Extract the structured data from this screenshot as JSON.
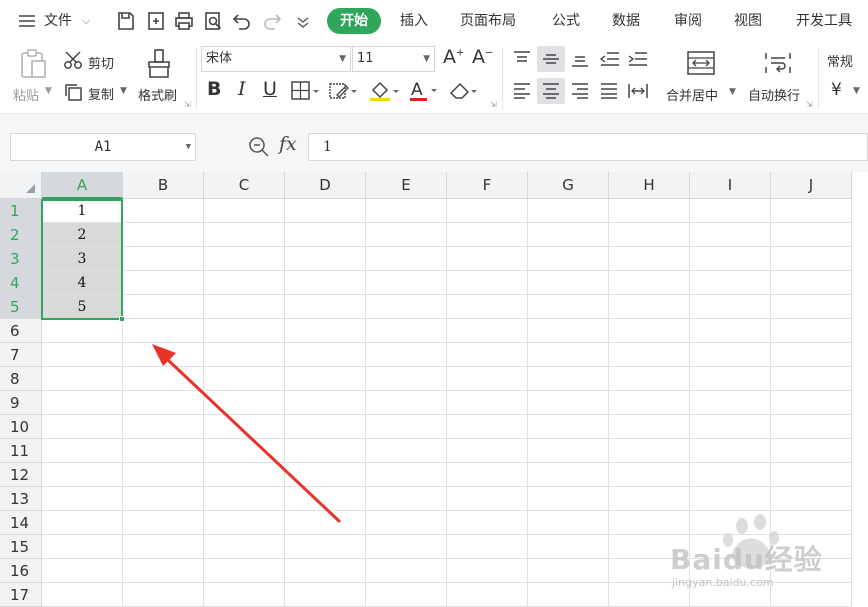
{
  "menu": {
    "file_label": "文件",
    "tabs": [
      "开始",
      "插入",
      "页面布局",
      "公式",
      "数据",
      "审阅",
      "视图",
      "开发工具"
    ]
  },
  "ribbon": {
    "paste": "粘贴",
    "cut": "剪切",
    "copy": "复制",
    "format_painter": "格式刷",
    "font_name": "宋体",
    "font_size": "11",
    "merge_center": "合并居中",
    "wrap_text": "自动换行",
    "number_format": "常规",
    "currency": "¥"
  },
  "formula_bar": {
    "name_box": "A1",
    "fx": "fx",
    "value": "1"
  },
  "sheet": {
    "columns": [
      "A",
      "B",
      "C",
      "D",
      "E",
      "F",
      "G",
      "H",
      "I",
      "J"
    ],
    "rows": [
      "1",
      "2",
      "3",
      "4",
      "5",
      "6",
      "7",
      "8",
      "9",
      "10",
      "11",
      "12",
      "13",
      "14",
      "15",
      "16",
      "17"
    ],
    "col_a_values": [
      "1",
      "2",
      "3",
      "4",
      "5"
    ],
    "selected_range": "A1:A5"
  },
  "watermark": {
    "brand": "Baidu经验",
    "url": "jingyan.baidu.com"
  },
  "colors": {
    "accent": "#2fa65c",
    "arrow": "#e8332a"
  }
}
